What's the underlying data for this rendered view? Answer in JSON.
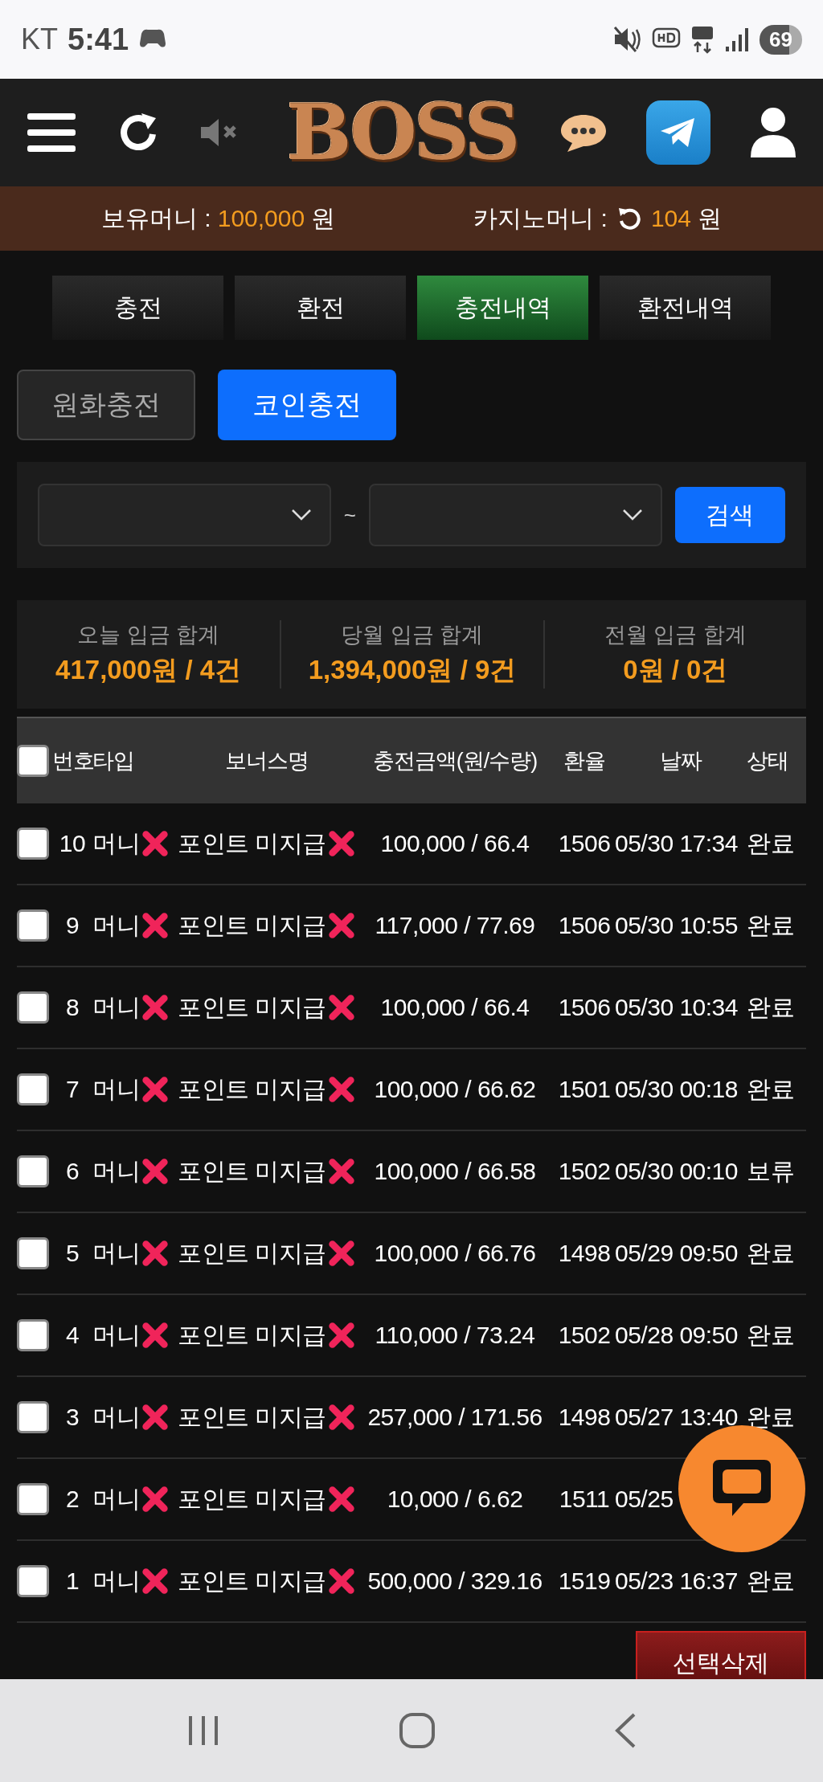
{
  "status_bar": {
    "carrier": "KT",
    "time": "5:41",
    "battery": "69"
  },
  "header": {
    "logo": "BOSS"
  },
  "balance": {
    "money_label": "보유머니 :",
    "money_value": "100,000",
    "money_unit": "원",
    "casino_label": "카지노머니 :",
    "casino_value": "104",
    "casino_unit": "원"
  },
  "tabs": [
    {
      "label": "충전",
      "selected": false
    },
    {
      "label": "환전",
      "selected": false
    },
    {
      "label": "충전내역",
      "selected": true
    },
    {
      "label": "환전내역",
      "selected": false
    }
  ],
  "charge_types": [
    {
      "label": "원화충전",
      "selected": false
    },
    {
      "label": "코인충전",
      "selected": true
    }
  ],
  "filter": {
    "separator": "~",
    "search_button": "검색"
  },
  "summary": [
    {
      "label": "오늘 입금 합계",
      "value": "417,000원 / 4건"
    },
    {
      "label": "당월 입금 합계",
      "value": "1,394,000원 / 9건"
    },
    {
      "label": "전월 입금 합계",
      "value": "0원 / 0건"
    }
  ],
  "table": {
    "select_all_checked": false,
    "columns": [
      "번호",
      "타입",
      "보너스명",
      "충전금액(원/수량)",
      "환율",
      "날짜",
      "상태"
    ],
    "rows": [
      {
        "checked": false,
        "number": "10",
        "type": "머니",
        "bonus": "포인트 미지급",
        "amount": "100,000 / 66.4",
        "rate": "1506",
        "date": "05/30 17:34",
        "status": "완료"
      },
      {
        "checked": false,
        "number": "9",
        "type": "머니",
        "bonus": "포인트 미지급",
        "amount": "117,000 / 77.69",
        "rate": "1506",
        "date": "05/30 10:55",
        "status": "완료"
      },
      {
        "checked": false,
        "number": "8",
        "type": "머니",
        "bonus": "포인트 미지급",
        "amount": "100,000 / 66.4",
        "rate": "1506",
        "date": "05/30 10:34",
        "status": "완료"
      },
      {
        "checked": false,
        "number": "7",
        "type": "머니",
        "bonus": "포인트 미지급",
        "amount": "100,000 / 66.62",
        "rate": "1501",
        "date": "05/30 00:18",
        "status": "완료"
      },
      {
        "checked": false,
        "number": "6",
        "type": "머니",
        "bonus": "포인트 미지급",
        "amount": "100,000 / 66.58",
        "rate": "1502",
        "date": "05/30 00:10",
        "status": "보류"
      },
      {
        "checked": false,
        "number": "5",
        "type": "머니",
        "bonus": "포인트 미지급",
        "amount": "100,000 / 66.76",
        "rate": "1498",
        "date": "05/29 09:50",
        "status": "완료"
      },
      {
        "checked": false,
        "number": "4",
        "type": "머니",
        "bonus": "포인트 미지급",
        "amount": "110,000 / 73.24",
        "rate": "1502",
        "date": "05/28 09:50",
        "status": "완료"
      },
      {
        "checked": false,
        "number": "3",
        "type": "머니",
        "bonus": "포인트 미지급",
        "amount": "257,000 / 171.56",
        "rate": "1498",
        "date": "05/27 13:40",
        "status": "완료"
      },
      {
        "checked": false,
        "number": "2",
        "type": "머니",
        "bonus": "포인트 미지급",
        "amount": "10,000 / 6.62",
        "rate": "1511",
        "date": "05/25"
      },
      {
        "checked": false,
        "number": "1",
        "type": "머니",
        "bonus": "포인트 미지급",
        "amount": "500,000 / 329.16",
        "rate": "1519",
        "date": "05/23 16:37",
        "status": "완료"
      }
    ]
  },
  "delete_button": "선택삭제"
}
